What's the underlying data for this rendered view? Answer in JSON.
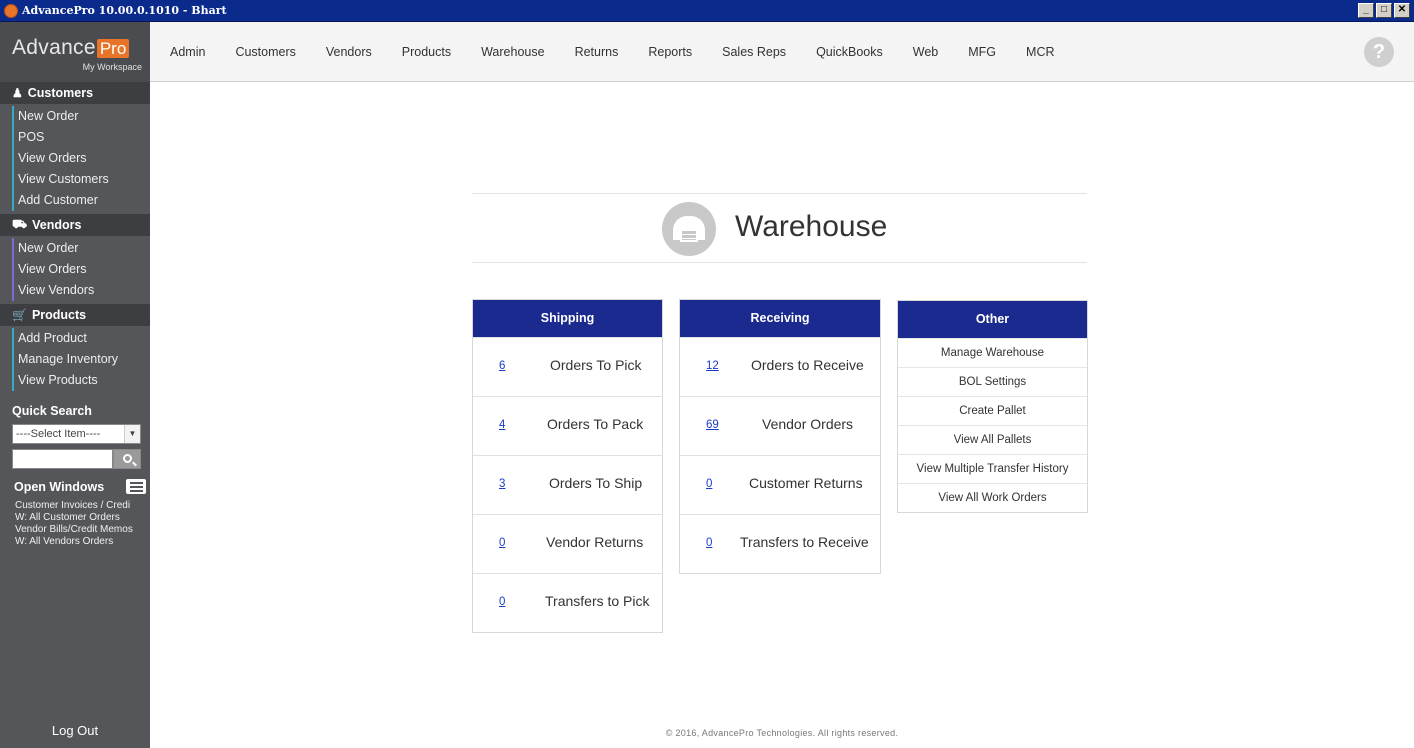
{
  "window": {
    "title": "AdvancePro 10.00.0.1010  - Bhart",
    "buttons": [
      "_",
      "□",
      "✕"
    ]
  },
  "logo": {
    "text": "Advance",
    "badge": "Pro",
    "subtitle": "My Workspace"
  },
  "sidebar": {
    "customers": {
      "title": "Customers",
      "items": [
        "New Order",
        "POS",
        "View Orders",
        "View Customers",
        "Add Customer"
      ]
    },
    "vendors": {
      "title": "Vendors",
      "items": [
        "New Order",
        "View Orders",
        "View Vendors"
      ]
    },
    "products": {
      "title": "Products",
      "items": [
        "Add Product",
        "Manage Inventory",
        "View Products"
      ]
    },
    "quick_search": {
      "title": "Quick Search",
      "select_value": "----Select Item----",
      "input_value": ""
    },
    "open_windows": {
      "title": "Open Windows",
      "items": [
        "Customer Invoices / Credi",
        "W: All Customer Orders",
        "Vendor Bills/Credit Memos",
        "W: All Vendors Orders"
      ]
    },
    "logout": "Log Out"
  },
  "topnav": {
    "items": [
      "Admin",
      "Customers",
      "Vendors",
      "Products",
      "Warehouse",
      "Returns",
      "Reports",
      "Sales Reps",
      "QuickBooks",
      "Web",
      "MFG",
      "MCR"
    ],
    "help": "?"
  },
  "page": {
    "title": "Warehouse"
  },
  "shipping": {
    "title": "Shipping",
    "rows": [
      {
        "count": "6",
        "label": "Orders To Pick"
      },
      {
        "count": "4",
        "label": "Orders To Pack"
      },
      {
        "count": "3",
        "label": "Orders To Ship"
      },
      {
        "count": "0",
        "label": "Vendor Returns"
      },
      {
        "count": "0",
        "label": "Transfers to Pick"
      }
    ]
  },
  "receiving": {
    "title": "Receiving",
    "rows": [
      {
        "count": "12",
        "label": "Orders to Receive"
      },
      {
        "count": "69",
        "label": "Vendor Orders"
      },
      {
        "count": "0",
        "label": "Customer Returns"
      },
      {
        "count": "0",
        "label": "Transfers to Receive"
      }
    ]
  },
  "other": {
    "title": "Other",
    "items": [
      "Manage Warehouse",
      "BOL Settings",
      "Create Pallet",
      "View All Pallets",
      "View Multiple Transfer History",
      "View All Work Orders"
    ]
  },
  "footer": "© 2016, AdvancePro Technologies. All rights reserved.",
  "colors": {
    "panel_header": "#1b2a8e",
    "sidebar": "#54565a",
    "brand_orange": "#e8742a",
    "link": "#1a3cc8"
  }
}
